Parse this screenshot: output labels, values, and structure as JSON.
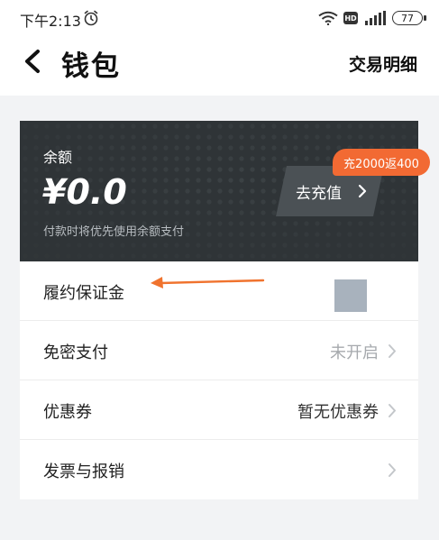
{
  "status_bar": {
    "time": "下午2:13",
    "hd": "HD",
    "battery": "77",
    "icons": [
      "alarm-icon",
      "wifi-icon",
      "hd-icon",
      "signal-icon",
      "battery-icon"
    ]
  },
  "nav": {
    "title": "钱包",
    "right_action": "交易明细",
    "back_icon": "chevron-left-icon"
  },
  "wallet_card": {
    "label": "余额",
    "amount": "¥0.0",
    "hint": "付款时将优先使用余额支付",
    "recharge_label": "去充值",
    "promo": "充2000返400",
    "colors": {
      "card": "#2f3437",
      "promo": "#f26a33"
    }
  },
  "list": {
    "items": [
      {
        "label": "履约保证金",
        "value": ""
      },
      {
        "label": "免密支付",
        "value": "未开启"
      },
      {
        "label": "优惠券",
        "value": "暂无优惠券"
      },
      {
        "label": "发票与报销",
        "value": ""
      }
    ]
  },
  "annotation": {
    "arrow_color": "#f0732e"
  }
}
